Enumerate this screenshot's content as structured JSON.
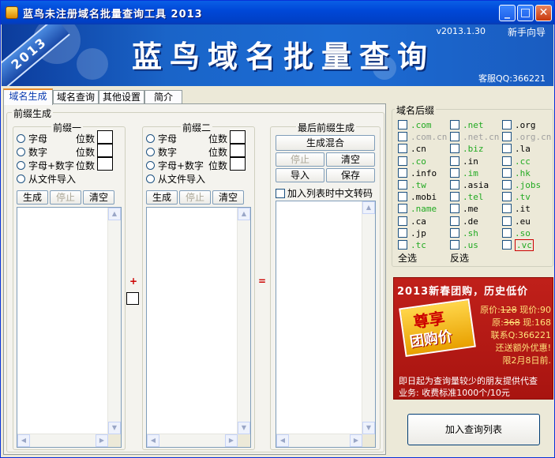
{
  "window": {
    "title": "蓝鸟未注册域名批量查询工具 2013",
    "controls": {
      "minimize": "_",
      "maximize": "□",
      "close": "✕"
    }
  },
  "banner": {
    "year_ribbon": "2013",
    "big_title": "蓝鸟域名批量查询",
    "version": "v2013.1.30",
    "guide_link": "新手向导",
    "support_qq": "客服QQ:366221"
  },
  "tabs": [
    {
      "label": "域名生成",
      "active": true
    },
    {
      "label": "域名查询",
      "active": false
    },
    {
      "label": "其他设置",
      "active": false
    },
    {
      "label": "简介",
      "active": false
    }
  ],
  "prefix": {
    "group_label": "前缀生成",
    "prefix1": {
      "title": "前缀一",
      "options": [
        "字母",
        "数字",
        "字母+数字",
        "从文件导入"
      ],
      "digit_label": "位数",
      "buttons": {
        "generate": "生成",
        "stop": "停止",
        "clear": "清空"
      }
    },
    "prefix2": {
      "title": "前缀二",
      "options": [
        "字母",
        "数字",
        "字母+数字",
        "从文件导入"
      ],
      "digit_label": "位数",
      "buttons": {
        "generate": "生成",
        "stop": "停止",
        "clear": "清空"
      }
    },
    "plus_sign": "+",
    "equals_sign": "=",
    "final": {
      "title": "最后前缀生成",
      "merge_button": "生成混合",
      "stop_button": "停止",
      "clear_button": "清空",
      "import_button": "导入",
      "save_button": "保存",
      "convert_checkbox": "加入列表时中文转码"
    }
  },
  "suffix": {
    "group_label": "域名后缀",
    "items": [
      [
        {
          "text": ".com",
          "color": "green"
        },
        {
          "text": ".net",
          "color": "green"
        },
        {
          "text": ".org",
          "color": "black"
        }
      ],
      [
        {
          "text": ".com.cn",
          "color": "gray"
        },
        {
          "text": ".net.cn",
          "color": "gray"
        },
        {
          "text": ".org.cn",
          "color": "gray"
        }
      ],
      [
        {
          "text": ".cn",
          "color": "black"
        },
        {
          "text": ".biz",
          "color": "green"
        },
        {
          "text": ".la",
          "color": "black"
        }
      ],
      [
        {
          "text": ".co",
          "color": "green"
        },
        {
          "text": ".in",
          "color": "black"
        },
        {
          "text": ".cc",
          "color": "green"
        }
      ],
      [
        {
          "text": ".info",
          "color": "black"
        },
        {
          "text": ".im",
          "color": "green"
        },
        {
          "text": ".hk",
          "color": "green"
        }
      ],
      [
        {
          "text": ".tw",
          "color": "green"
        },
        {
          "text": ".asia",
          "color": "black"
        },
        {
          "text": ".jobs",
          "color": "green"
        }
      ],
      [
        {
          "text": ".mobi",
          "color": "black"
        },
        {
          "text": ".tel",
          "color": "green"
        },
        {
          "text": ".tv",
          "color": "green"
        }
      ],
      [
        {
          "text": ".name",
          "color": "green"
        },
        {
          "text": ".me",
          "color": "black"
        },
        {
          "text": ".it",
          "color": "black"
        }
      ],
      [
        {
          "text": ".ca",
          "color": "black"
        },
        {
          "text": ".de",
          "color": "black"
        },
        {
          "text": ".eu",
          "color": "black"
        }
      ],
      [
        {
          "text": ".jp",
          "color": "black"
        },
        {
          "text": ".sh",
          "color": "green"
        },
        {
          "text": ".so",
          "color": "green"
        }
      ],
      [
        {
          "text": ".tc",
          "color": "green"
        },
        {
          "text": ".us",
          "color": "green"
        },
        {
          "text": ".vc",
          "color": "green"
        }
      ]
    ],
    "select_all": "全选",
    "invert": "反选"
  },
  "ad": {
    "headline": "2013新春团购，历史低价",
    "badge_top": "尊享",
    "badge_bottom": "团购价",
    "orig_price_label": "原价:",
    "orig_price": "128",
    "now_price_label": " 现价:90",
    "line2_label": "原:",
    "line2_orig": "368",
    "line2_now": " 现:168",
    "contact": "联系Q:366221",
    "bonus": "还送额外优惠!",
    "deadline": "限2月8日前.",
    "footer1": "即日起为查询量较少的朋友提供代查",
    "footer2": "业务: 收费标准1000个/10元"
  },
  "add_to_query_button": "加入查询列表"
}
